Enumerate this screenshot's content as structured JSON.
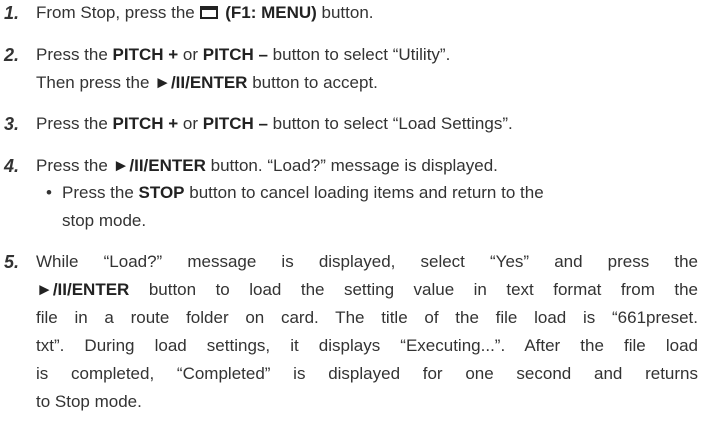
{
  "steps": [
    {
      "number": "1.",
      "a": "From Stop, press the ",
      "b": "(F1: MENU)",
      "c": " button."
    },
    {
      "number": "2.",
      "a": "Press the ",
      "b": "PITCH +",
      "c": " or ",
      "d": "PITCH –",
      "e": " button to select “Utility”.",
      "f": "Then press the ",
      "g": "►/II/ENTER",
      "h": " button to accept."
    },
    {
      "number": "3.",
      "a": "Press the ",
      "b": "PITCH +",
      "c": " or ",
      "d": "PITCH –",
      "e": " button to select “Load Settings”."
    },
    {
      "number": "4.",
      "a": "Press the ",
      "b": "►/II/ENTER",
      "c": " button. “Load?” message is displayed.",
      "bullet": "•",
      "bullet_a": "Press the ",
      "bullet_b": "STOP",
      "bullet_c": " button to cancel loading items and return to the",
      "bullet_d": "stop mode."
    },
    {
      "number": "5.",
      "l1": "While “Load?” message is displayed, select “Yes” and press the",
      "l2_b": "►/II/ENTER",
      "l2_c": " button to load the setting value in text format from the",
      "l3": "file in a route folder on card. The title of the file load is “661preset.",
      "l4": "txt”. During load settings, it displays “Executing...”. After the file load",
      "l5": "is completed, “Completed” is displayed for one second and returns",
      "l6": "to Stop mode."
    }
  ]
}
